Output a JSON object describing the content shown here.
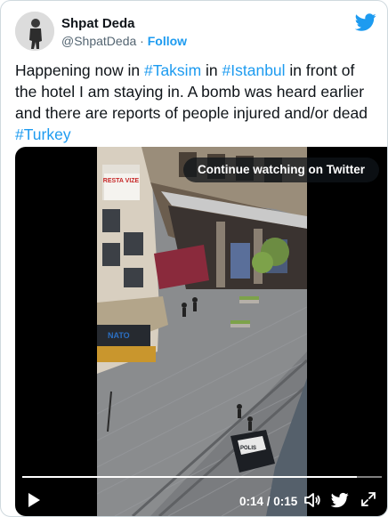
{
  "user": {
    "name": "Shpat Deda",
    "handle": "@ShpatDeda",
    "separator": "·",
    "follow_label": "Follow"
  },
  "tweet": {
    "t1": "Happening now in ",
    "tag1": "#Taksim",
    "t2": " in ",
    "tag2": "#Istanbul",
    "t3": " in front of the hotel I am staying in. A bomb was heard earlier and there are reports of people injured and/or dead ",
    "tag3": "#Turkey"
  },
  "video": {
    "overlay_button": "Continue watching on Twitter",
    "current_time": "0:14",
    "duration": "0:15",
    "time_separator": " / ",
    "progress_fraction": 0.93,
    "scene_signs": {
      "hotel_sign": "RESTA VIZE",
      "shop_sign": "NATO",
      "police_marking": "POLIS"
    }
  },
  "icons": {
    "brand": "twitter-bird-icon",
    "play": "play-icon",
    "volume": "volume-icon",
    "twitter_small": "twitter-small-icon",
    "fullscreen": "fullscreen-icon"
  },
  "colors": {
    "accent": "#1d9bf0",
    "text": "#0f1419",
    "secondary": "#536471"
  }
}
